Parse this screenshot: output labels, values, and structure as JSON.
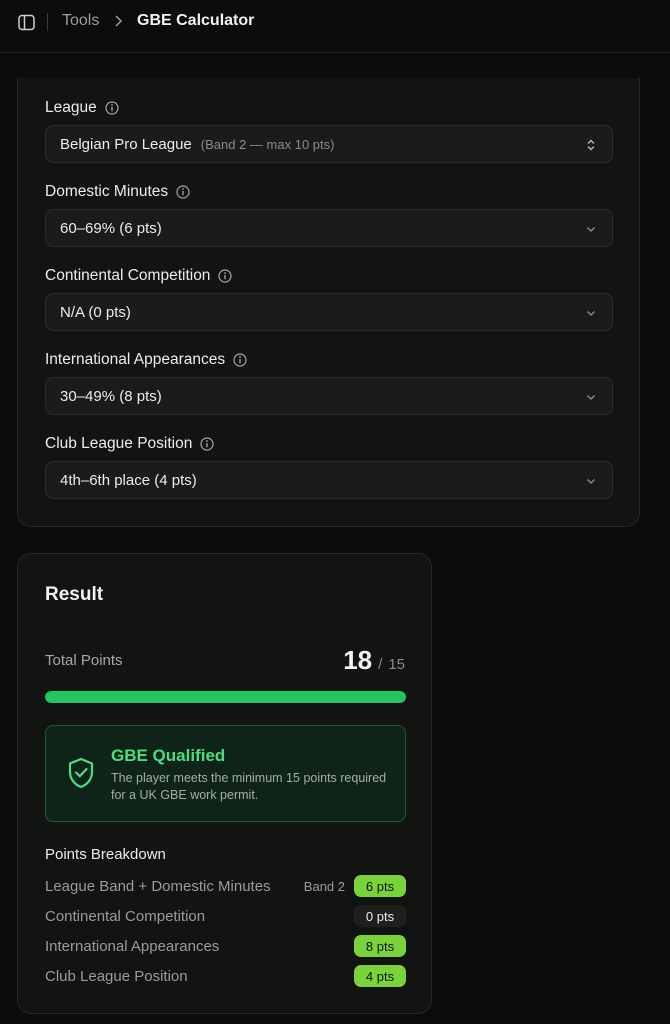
{
  "header": {
    "breadcrumb_parent": "Tools",
    "breadcrumb_current": "GBE Calculator",
    "icons": [
      "sidebar-toggle-icon",
      "chevron-right-icon"
    ]
  },
  "form": {
    "fields": [
      {
        "label": "League",
        "value": "Belgian Pro League",
        "hint": "(Band 2 — max 10 pts)",
        "control": "updown"
      },
      {
        "label": "Domestic Minutes",
        "value": "60–69% (6 pts)",
        "hint": "",
        "control": "chevron"
      },
      {
        "label": "Continental Competition",
        "value": "N/A (0 pts)",
        "hint": "",
        "control": "chevron"
      },
      {
        "label": "International Appearances",
        "value": "30–49% (8 pts)",
        "hint": "",
        "control": "chevron"
      },
      {
        "label": "Club League Position",
        "value": "4th–6th place (4 pts)",
        "hint": "",
        "control": "chevron"
      }
    ]
  },
  "result": {
    "title": "Result",
    "total_label": "Total Points",
    "total_value": "18",
    "total_slash": "/",
    "total_max": "15",
    "progress_fraction": 1.0,
    "status_title": "GBE Qualified",
    "status_text": "The player meets the minimum 15 points required for a UK GBE work permit.",
    "breakdown_title": "Points Breakdown",
    "breakdown": [
      {
        "label": "League Band + Domestic Minutes",
        "extra": "Band 2",
        "points": "6 pts",
        "active": true
      },
      {
        "label": "Continental Competition",
        "extra": "",
        "points": "0 pts",
        "active": false
      },
      {
        "label": "International Appearances",
        "extra": "",
        "points": "8 pts",
        "active": true
      },
      {
        "label": "Club League Position",
        "extra": "",
        "points": "4 pts",
        "active": true
      }
    ]
  },
  "colors": {
    "accent": "#22c55e",
    "pill_active": "#7bd33c",
    "background": "#0b0c0b",
    "card": "#121412"
  }
}
